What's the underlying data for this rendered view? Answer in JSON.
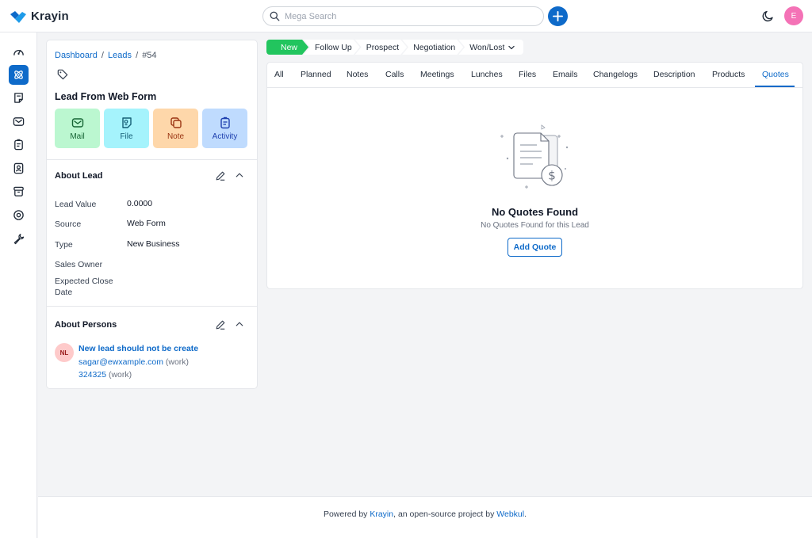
{
  "header": {
    "brand": "Krayin",
    "search_placeholder": "Mega Search",
    "avatar_initial": "E",
    "brand_color": "#0e6ac9"
  },
  "sidenav": {
    "items": [
      {
        "icon": "dashboard-icon",
        "active": false
      },
      {
        "icon": "leads-icon",
        "active": true
      },
      {
        "icon": "quotes-icon",
        "active": false
      },
      {
        "icon": "mail-icon",
        "active": false
      },
      {
        "icon": "activities-icon",
        "active": false
      },
      {
        "icon": "contacts-icon",
        "active": false
      },
      {
        "icon": "products-icon",
        "active": false
      },
      {
        "icon": "settings-icon",
        "active": false
      },
      {
        "icon": "configuration-icon",
        "active": false
      }
    ]
  },
  "breadcrumb": {
    "dashboard": "Dashboard",
    "leads": "Leads",
    "current": "#54",
    "sep": "/"
  },
  "lead": {
    "title": "Lead From Web Form",
    "actions": {
      "mail": "Mail",
      "file": "File",
      "note": "Note",
      "activity": "Activity"
    }
  },
  "about_lead": {
    "title": "About Lead",
    "attributes": [
      {
        "label": "Lead Value",
        "value": "0.0000"
      },
      {
        "label": "Source",
        "value": "Web Form"
      },
      {
        "label": "Type",
        "value": "New Business"
      },
      {
        "label": "Sales Owner",
        "value": ""
      },
      {
        "label": "Expected Close Date",
        "value": ""
      }
    ]
  },
  "about_persons": {
    "title": "About Persons",
    "person": {
      "initials": "NL",
      "name": "New lead should not be create",
      "email": "sagar@ewxample.com",
      "email_type": "(work)",
      "phone": "324325",
      "phone_type": "(work)"
    }
  },
  "stages": [
    "New",
    "Follow Up",
    "Prospect",
    "Negotiation",
    "Won/Lost"
  ],
  "tabs": [
    "All",
    "Planned",
    "Notes",
    "Calls",
    "Meetings",
    "Lunches",
    "Files",
    "Emails",
    "Changelogs",
    "Description",
    "Products",
    "Quotes"
  ],
  "active_tab": "Quotes",
  "empty_state": {
    "title": "No Quotes Found",
    "subtitle": "No Quotes Found for this Lead",
    "button": "Add Quote"
  },
  "footer": {
    "prefix": "Powered by",
    "krayin": "Krayin",
    "middle": ", an open-source project by",
    "webkul": "Webkul",
    "suffix": "."
  }
}
